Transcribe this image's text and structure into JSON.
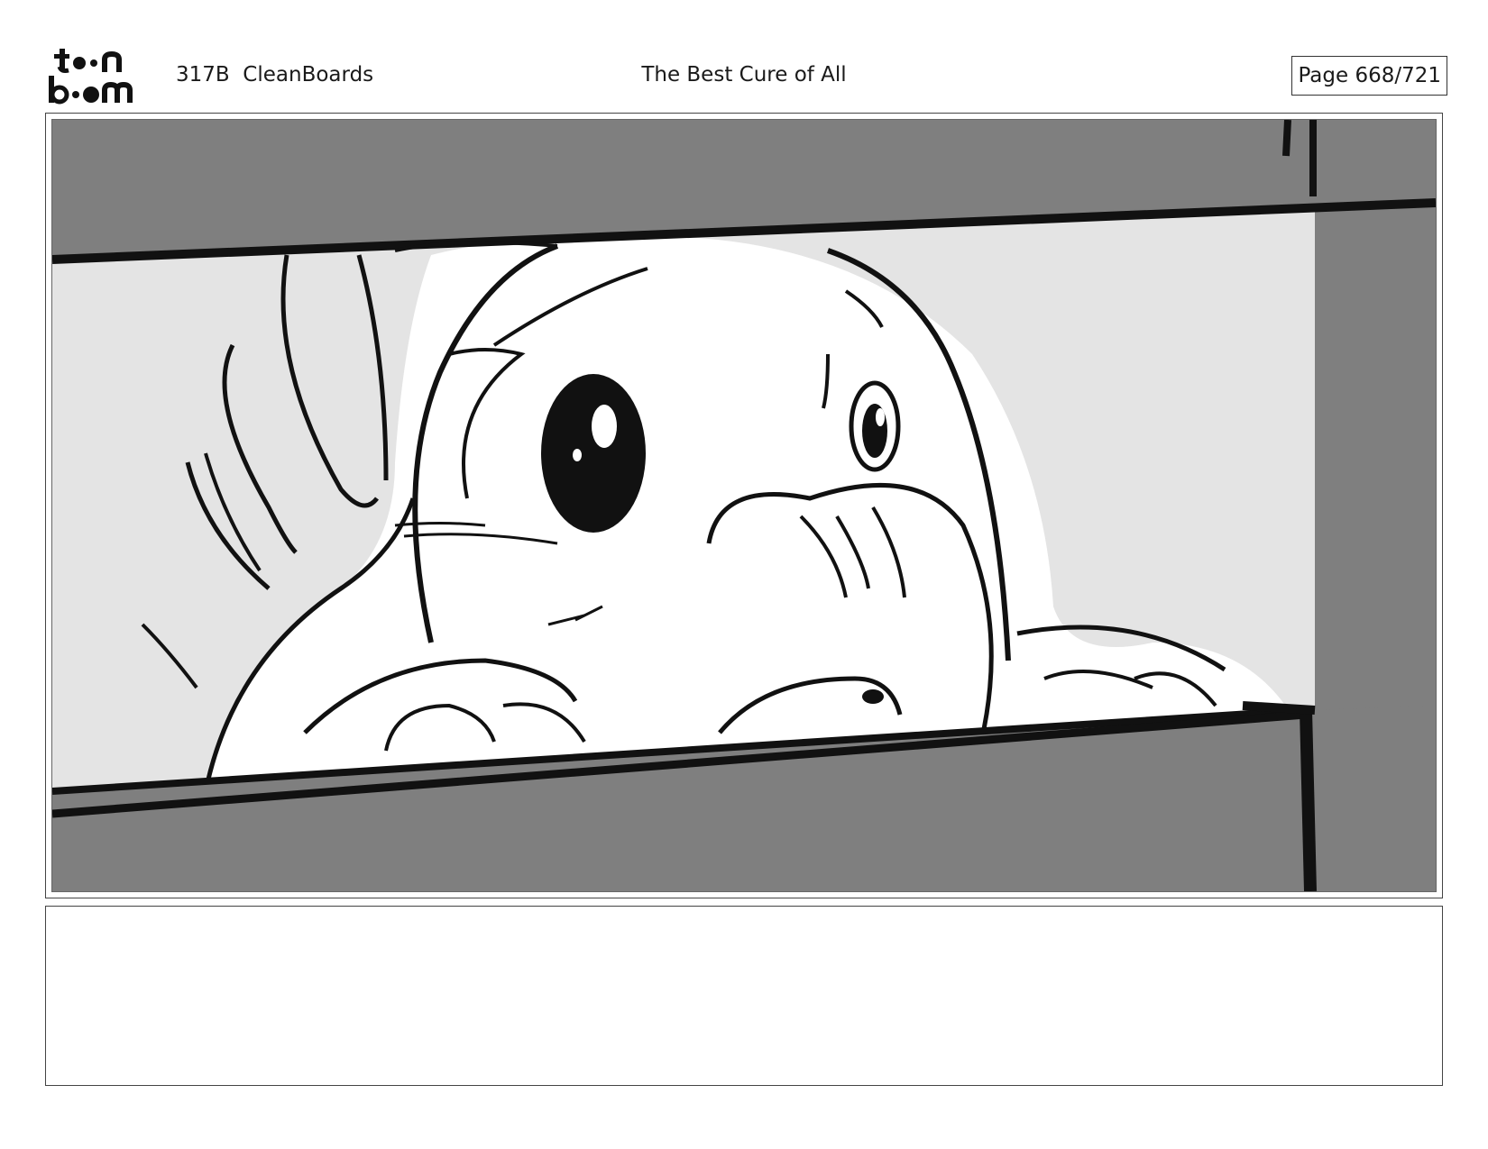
{
  "header": {
    "logo": {
      "line1": "toon",
      "line2": "boom",
      "icon": "toonboom-logo"
    },
    "project": "317B  CleanBoards",
    "title": "The Best Cure of All",
    "page": "Page 668/721"
  },
  "panel": {
    "image": "storyboard-sketch-character-peeking-between-shelves",
    "caption": ""
  }
}
